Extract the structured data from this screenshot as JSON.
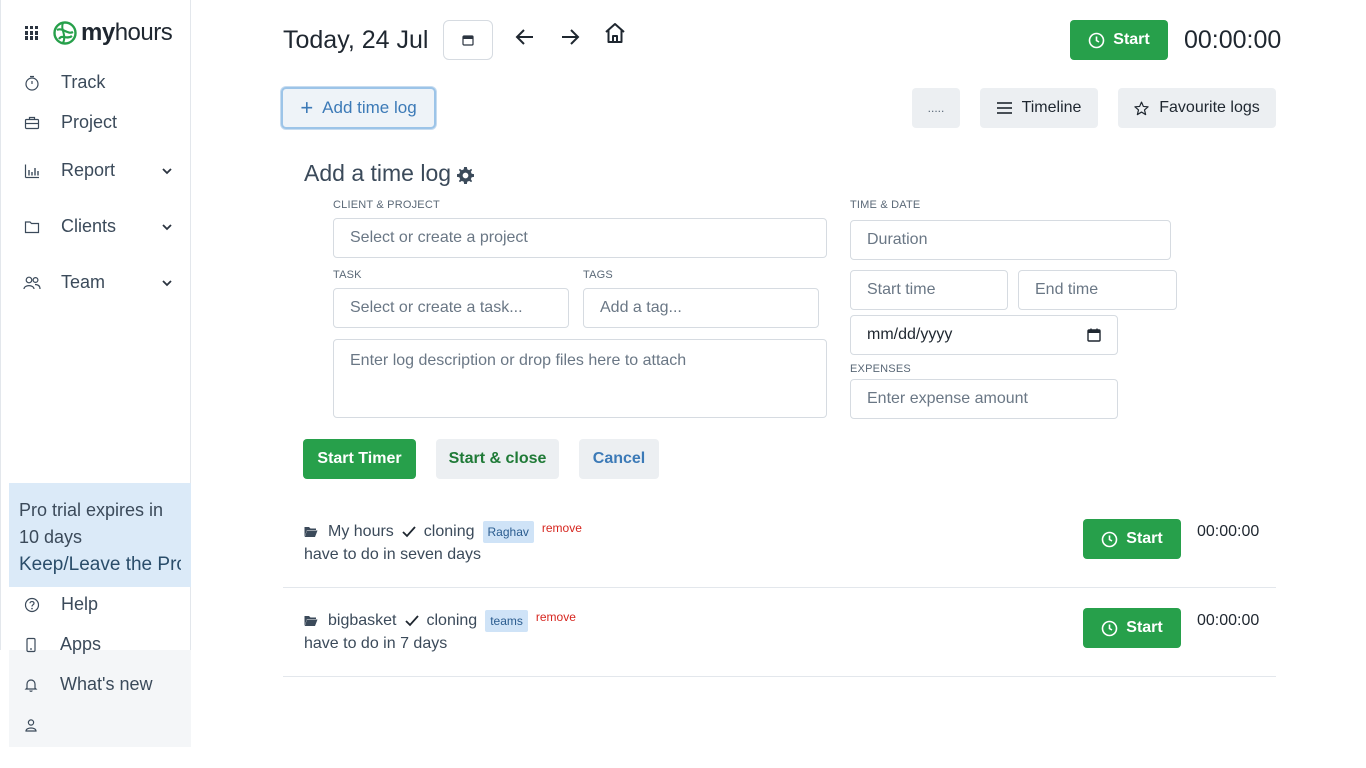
{
  "brand": {
    "name_bold": "my",
    "name_rest": "hours"
  },
  "sidebar": {
    "items": [
      {
        "label": "Track",
        "icon": "stopwatch-icon"
      },
      {
        "label": "Project",
        "icon": "briefcase-icon"
      },
      {
        "label": "Report",
        "icon": "bar-chart-icon",
        "has_submenu": true
      },
      {
        "label": "Clients",
        "icon": "folder-icon",
        "has_submenu": true
      },
      {
        "label": "Team",
        "icon": "people-icon",
        "has_submenu": true
      }
    ],
    "trial_text": "Pro trial expires in 10 days",
    "trial_link": "Keep/Leave the Pro",
    "bottom_items": [
      {
        "label": "Help",
        "icon": "question-circle-icon"
      },
      {
        "label": "Apps",
        "icon": "phone-icon"
      },
      {
        "label": "What's new",
        "icon": "bell-icon"
      },
      {
        "label": "",
        "icon": "user-icon"
      }
    ]
  },
  "header": {
    "date_title": "Today, 24 Jul",
    "start_label": "Start",
    "timer": "00:00:00"
  },
  "toolbar": {
    "add_time_log": "Add time log",
    "more_label": ".....",
    "timeline_label": "Timeline",
    "favourite_label": "Favourite logs"
  },
  "form": {
    "title": "Add a time log",
    "client_project_label": "CLIENT & PROJECT",
    "client_project_placeholder": "Select or create a project",
    "task_label": "TASK",
    "task_placeholder": "Select or create a task...",
    "tags_label": "TAGS",
    "tags_placeholder": "Add a tag...",
    "description_placeholder": "Enter log description or drop files here to attach",
    "time_date_label": "TIME & DATE",
    "duration_placeholder": "Duration",
    "start_time_placeholder": "Start time",
    "end_time_placeholder": "End time",
    "date_placeholder": "mm/dd/yyyy",
    "expenses_label": "EXPENSES",
    "expenses_placeholder": "Enter expense amount",
    "start_timer_label": "Start Timer",
    "start_close_label": "Start & close",
    "cancel_label": "Cancel"
  },
  "logs": [
    {
      "project": "My hours",
      "task": "cloning",
      "tag": "Raghav",
      "remove": "remove",
      "description": "have to do in seven days",
      "start_label": "Start",
      "time": "00:00:00"
    },
    {
      "project": "bigbasket",
      "task": "cloning",
      "tag": "teams",
      "remove": "remove",
      "description": "have to do in 7 days",
      "start_label": "Start",
      "time": "00:00:00"
    }
  ],
  "colors": {
    "accent_green": "#27a04b",
    "accent_blue": "#3c7ab7",
    "remove_red": "#d6261f",
    "tag_bg": "#cfe3f7"
  }
}
